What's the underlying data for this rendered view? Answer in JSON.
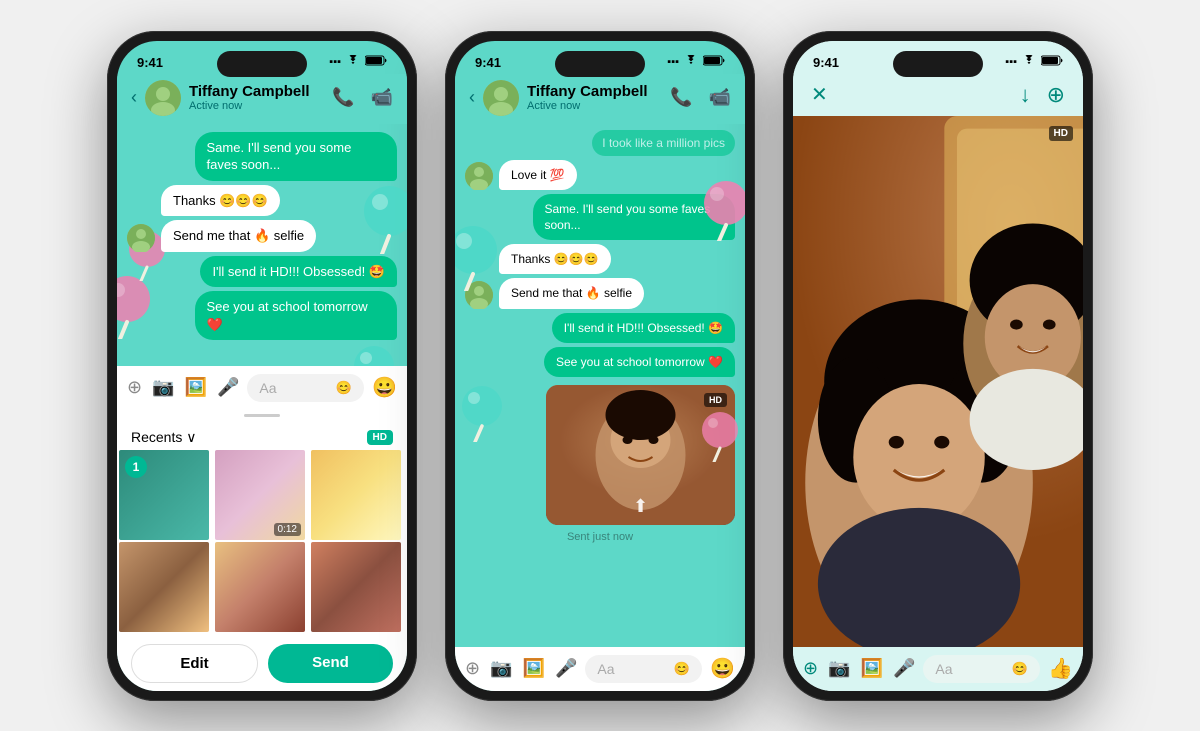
{
  "phones": [
    {
      "id": "phone1",
      "statusBar": {
        "time": "9:41",
        "signal": "▪▪▪",
        "wifi": "wifi",
        "battery": "battery"
      },
      "header": {
        "backLabel": "‹",
        "contactName": "Tiffany Campbell",
        "statusText": "Active now",
        "callIcon": "📞",
        "videoIcon": "📹"
      },
      "messages": [
        {
          "type": "sent",
          "text": "Same. I'll send you some faves soon..."
        },
        {
          "type": "received",
          "text": "Thanks 😊😊😊",
          "hasAvatar": false
        },
        {
          "type": "received",
          "text": "Send me that 🔥 selfie",
          "hasAvatar": true
        },
        {
          "type": "sent",
          "text": "I'll send it HD!!! Obsessed! 🤩"
        },
        {
          "type": "sent",
          "text": "See you at school tomorrow ❤️"
        }
      ],
      "inputBar": {
        "placeholder": "Aa",
        "addIcon": "+",
        "cameraIcon": "📷",
        "photoIcon": "🖼",
        "micIcon": "🎤"
      },
      "mediaPicker": {
        "recentsLabel": "Recents",
        "chevron": "∨",
        "hdLabel": "HD",
        "editLabel": "Edit",
        "sendLabel": "Send",
        "thumbCount": 1
      }
    },
    {
      "id": "phone2",
      "statusBar": {
        "time": "9:41"
      },
      "header": {
        "backLabel": "‹",
        "contactName": "Tiffany Campbell",
        "statusText": "Active now"
      },
      "messages": [
        {
          "type": "sent-partial",
          "text": "I took like a million pics"
        },
        {
          "type": "received-love",
          "text": "Love it 💯",
          "hasAvatar": true
        },
        {
          "type": "sent",
          "text": "Same. I'll send you some faves soon..."
        },
        {
          "type": "received",
          "text": "Thanks 😊😊😊",
          "hasAvatar": false
        },
        {
          "type": "received",
          "text": "Send me that 🔥 selfie",
          "hasAvatar": true
        },
        {
          "type": "sent",
          "text": "I'll send it HD!!! Obsessed! 🤩"
        },
        {
          "type": "sent",
          "text": "See you at school tomorrow ❤️"
        }
      ],
      "photoPreview": {
        "sentTimestamp": "Sent just now",
        "hdBadge": "HD"
      },
      "inputBar": {
        "placeholder": "Aa"
      }
    },
    {
      "id": "phone3",
      "statusBar": {
        "time": "9:41"
      },
      "header": {
        "closeIcon": "✕",
        "downloadIcon": "↓",
        "shareIcon": "+"
      },
      "hdBadge": "HD",
      "inputBar": {
        "placeholder": "Aa",
        "addIcon": "+",
        "cameraIcon": "📷",
        "photoIcon": "🖼",
        "micIcon": "🎤",
        "thumbUpIcon": "👍"
      }
    }
  ]
}
